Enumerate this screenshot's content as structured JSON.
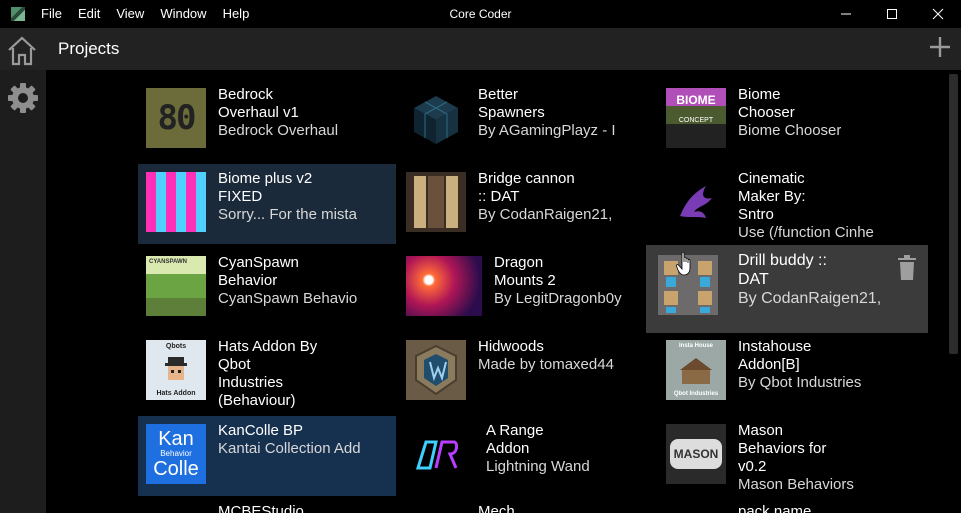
{
  "window": {
    "title": "Core Coder",
    "menu": [
      "File",
      "Edit",
      "View",
      "Window",
      "Help"
    ]
  },
  "header": {
    "title": "Projects"
  },
  "projects": [
    {
      "title": "Bedrock Overhaul v1",
      "title_lines": [
        "Bedrock",
        "Overhaul v1"
      ],
      "subtitle": "Bedrock Overhaul",
      "thumb": "80"
    },
    {
      "title": "Better Spawners",
      "title_lines": [
        "Better",
        "Spawners"
      ],
      "subtitle": "By AGamingPlayz - I",
      "thumb": "spawn"
    },
    {
      "title": "Biome Chooser",
      "title_lines": [
        "Biome",
        "Chooser"
      ],
      "subtitle": "Biome Chooser",
      "thumb": "biomec"
    },
    {
      "title": "Biome plus v2 FIXED",
      "title_lines": [
        "Biome plus v2",
        "FIXED"
      ],
      "subtitle": "Sorry... For the mista",
      "thumb": "biomep"
    },
    {
      "title": "Bridge cannon :: DAT",
      "title_lines": [
        "Bridge cannon",
        ":: DAT"
      ],
      "subtitle": "By CodanRaigen21,",
      "thumb": "bridge"
    },
    {
      "title": "Cinematic Maker By: Sntro",
      "title_lines": [
        "Cinematic",
        "Maker By:",
        "Sntro"
      ],
      "subtitle": "Use (/function Cinhe",
      "thumb": "cine"
    },
    {
      "title": "CyanSpawn Behavior",
      "title_lines": [
        "CyanSpawn",
        "Behavior"
      ],
      "subtitle": "CyanSpawn Behavio",
      "thumb": "cyan"
    },
    {
      "title": "Dragon Mounts 2",
      "title_lines": [
        "Dragon",
        "Mounts 2"
      ],
      "subtitle": "By LegitDragonb0y",
      "thumb": "dragonm"
    },
    {
      "title": "Drill buddy :: DAT",
      "title_lines": [
        "Drill buddy ::",
        "DAT"
      ],
      "subtitle": "By CodanRaigen21,",
      "thumb": "drill"
    },
    {
      "title": "Hats Addon By Qbot Industries (Behaviour)",
      "title_lines": [
        "Hats Addon By",
        "Qbot",
        "Industries",
        "(Behaviour)"
      ],
      "subtitle": "",
      "thumb": "hats"
    },
    {
      "title": "Hidwoods",
      "title_lines": [
        "Hidwoods"
      ],
      "subtitle": "Made by tomaxed44",
      "thumb": "hid"
    },
    {
      "title": "Instahouse Addon[B]",
      "title_lines": [
        "Instahouse",
        "Addon[B]"
      ],
      "subtitle": "By Qbot Industries",
      "thumb": "insta"
    },
    {
      "title": "KanColle BP",
      "title_lines": [
        "KanColle BP"
      ],
      "subtitle": "Kantai Collection Add",
      "thumb": "kan"
    },
    {
      "title": "A Range Addon",
      "title_lines": [
        "A Range",
        "Addon"
      ],
      "subtitle": "Lightning Wand",
      "thumb": "range"
    },
    {
      "title": "Mason Behaviors for v0.2",
      "title_lines": [
        "Mason",
        "Behaviors for",
        "v0.2"
      ],
      "subtitle": "Mason Behaviors",
      "thumb": "mason"
    }
  ],
  "partial_row": [
    "MCBEStudio",
    "Mech",
    "pack name"
  ],
  "thumb_text": {
    "bedrock": "80",
    "biome_chooser": "BIOME",
    "biome_chooser_sub": "CONCEPT",
    "kan_top": "Kan",
    "kan_mid": "Behavior",
    "kan_bottom": "Colle",
    "mason": "MASON",
    "hats_top": "Qbots",
    "hats_bottom": "Hats Addon",
    "insta_top": "Insta House",
    "insta_bottom": "Qbot Industries",
    "cyan_top": "CYANSPAWN"
  }
}
